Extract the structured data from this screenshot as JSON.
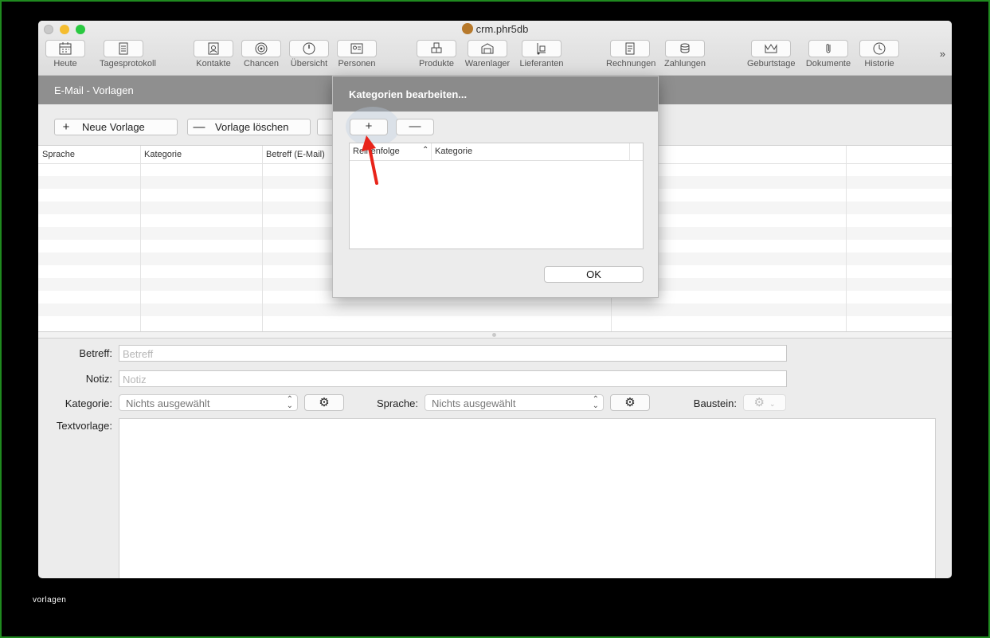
{
  "window": {
    "title": "crm.phr5db"
  },
  "toolbar": {
    "items": [
      {
        "label": "Heute",
        "icon": "calendar-icon"
      },
      {
        "label": "Tagesprotokoll",
        "icon": "notepad-icon"
      },
      {
        "label": "Kontakte",
        "icon": "contacts-icon"
      },
      {
        "label": "Chancen",
        "icon": "target-icon"
      },
      {
        "label": "Übersicht",
        "icon": "gauge-icon"
      },
      {
        "label": "Personen",
        "icon": "person-card-icon"
      },
      {
        "label": "Produkte",
        "icon": "boxes-icon"
      },
      {
        "label": "Warenlager",
        "icon": "warehouse-icon"
      },
      {
        "label": "Lieferanten",
        "icon": "handtruck-icon"
      },
      {
        "label": "Rechnungen",
        "icon": "invoice-icon"
      },
      {
        "label": "Zahlungen",
        "icon": "coins-icon"
      },
      {
        "label": "Geburtstage",
        "icon": "crown-icon"
      },
      {
        "label": "Dokumente",
        "icon": "paperclip-icon"
      },
      {
        "label": "Historie",
        "icon": "clock-icon"
      }
    ],
    "overflow": "»"
  },
  "section": {
    "title": "E-Mail - Vorlagen"
  },
  "actions": {
    "new_label": "Neue Vorlage",
    "new_sym": "+",
    "delete_label": "Vorlage löschen",
    "delete_sym": "—"
  },
  "table": {
    "columns": [
      "Sprache",
      "Kategorie",
      "Betreff (E-Mail)"
    ]
  },
  "form": {
    "betreff_label": "Betreff:",
    "betreff_placeholder": "Betreff",
    "notiz_label": "Notiz:",
    "notiz_placeholder": "Notiz",
    "kategorie_label": "Kategorie:",
    "kategorie_value": "Nichts ausgewählt",
    "sprache_label": "Sprache:",
    "sprache_value": "Nichts ausgewählt",
    "baustein_label": "Baustein:",
    "textvorlage_label": "Textvorlage:"
  },
  "dialog": {
    "title": "Kategorien bearbeiten...",
    "add_sym": "+",
    "remove_sym": "—",
    "columns": [
      "Reihenfolge",
      "Kategorie"
    ],
    "ok_label": "OK"
  },
  "caption": "vorlagen",
  "colors": {
    "annotation_arrow": "#e8241a",
    "section_bar": "#8f8f8f",
    "frame_border": "#1f8a1f"
  }
}
